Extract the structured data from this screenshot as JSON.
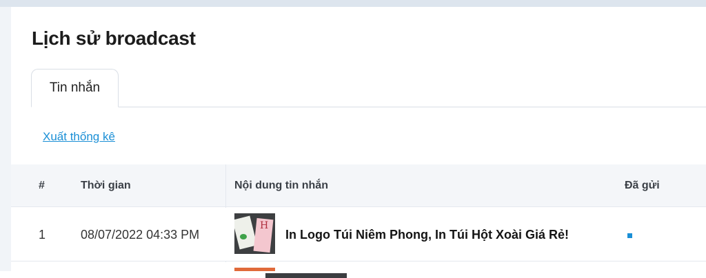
{
  "page": {
    "title": "Lịch sử broadcast"
  },
  "tabs": [
    {
      "label": "Tin nhắn",
      "active": true
    }
  ],
  "actions": {
    "export_label": "Xuất thống kê"
  },
  "table": {
    "columns": {
      "index": "#",
      "time": "Thời gian",
      "content": "Nội dung tin nhắn",
      "sent": "Đã gửi"
    },
    "rows": [
      {
        "index": "1",
        "time": "08/07/2022 04:33 PM",
        "content": "In Logo Túi Niêm Phong, In Túi Hột Xoài Giá Rẻ!",
        "thumbnail_icon": "product-image-icon",
        "sent_status_color": "#1a8fd6"
      }
    ]
  },
  "colors": {
    "accent": "#1a8fd6",
    "page_background": "#f1f4f8",
    "header_background": "#f4f6f9"
  }
}
